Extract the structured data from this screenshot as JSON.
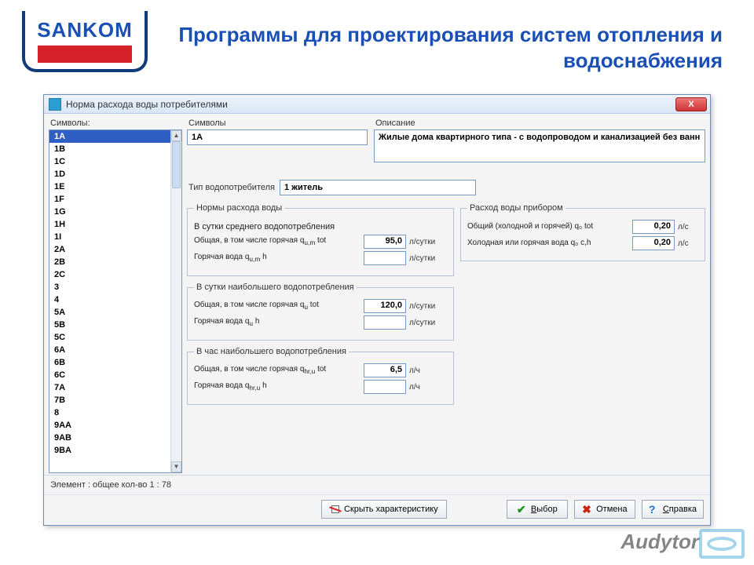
{
  "brand": "SANKOM",
  "page_title": "Программы для проектирования систем отопления и водоснабжения",
  "window": {
    "title": "Норма расхода воды потребителями",
    "close": "X"
  },
  "labels": {
    "symbols_left": "Символы:",
    "symbols_right": "Символы",
    "description": "Описание",
    "consumer_type": "Тип водопотребителя",
    "norms_legend": "Нормы расхода воды",
    "device_legend": "Расход воды прибором",
    "section_avg": "В сутки среднего водопотребления",
    "section_max_day": "В сутки наибольшего водопотребления",
    "section_max_hour": "В час наибольшего водопотребления",
    "row_total": "Общая, в том числе горячая q",
    "row_hot": "Горячая вода q",
    "unit_day": "л/сутки",
    "unit_hour": "л/ч",
    "dev_total": "Общий (холодной и горячей) q₀ tot",
    "dev_cold_hot": "Холодная или горячая вода q₀ c,h",
    "dev_unit": "л/с"
  },
  "symbols": [
    "1A",
    "1B",
    "1C",
    "1D",
    "1E",
    "1F",
    "1G",
    "1H",
    "1I",
    "2A",
    "2B",
    "2C",
    "3",
    "4",
    "5A",
    "5B",
    "5C",
    "6A",
    "6B",
    "6C",
    "7A",
    "7B",
    "8",
    "9AA",
    "9AB",
    "9BA"
  ],
  "selected_symbol": "1A",
  "fields": {
    "symbol": "1A",
    "description": "Жилые дома квартирного типа - с водопроводом и канализацией без ванн",
    "consumer_type": "1 житель"
  },
  "norms": {
    "avg_total": "95,0",
    "avg_hot": "",
    "maxday_total": "120,0",
    "maxday_hot": "",
    "maxhour_total": "6,5",
    "maxhour_hot": ""
  },
  "device": {
    "total": "0,20",
    "cold_hot": "0,20"
  },
  "status": "Элемент : общее кол-во 1 : 78",
  "buttons": {
    "hide": "Скрыть характеристику",
    "select": "Выбор",
    "cancel": "Отмена",
    "help": "Справка"
  },
  "watermark": "Audytor"
}
